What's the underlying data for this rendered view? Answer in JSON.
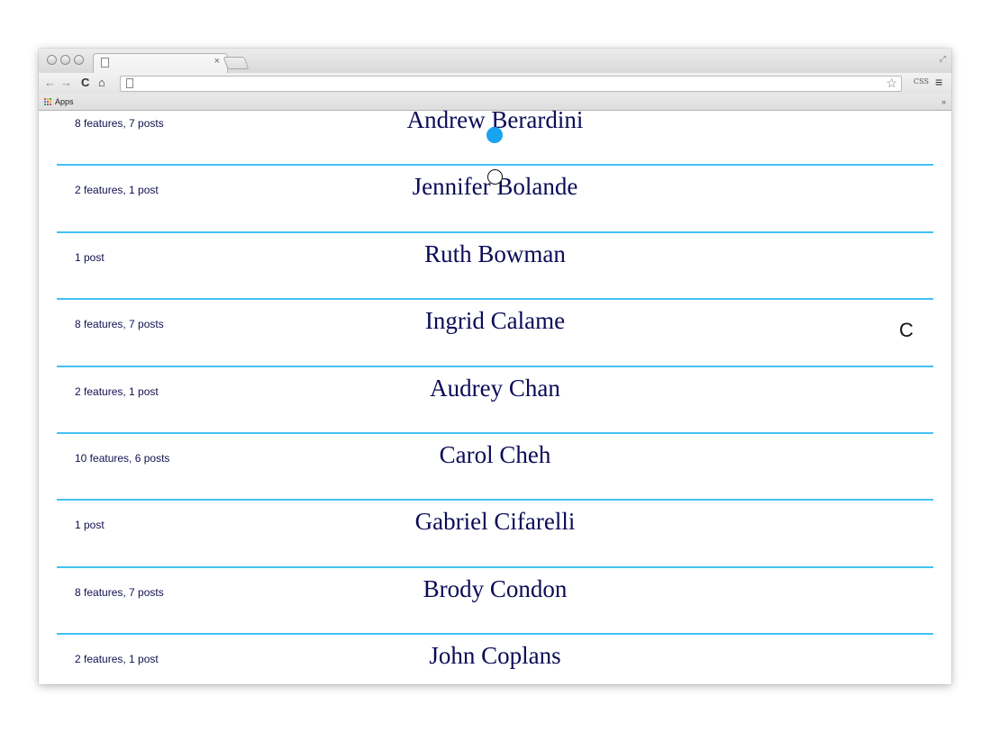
{
  "browser": {
    "tab_close": "×",
    "nav_back": "←",
    "nav_forward": "→",
    "nav_reload": "C",
    "nav_home": "⌂",
    "star": "☆",
    "extension_label": "CSS",
    "menu": "≡",
    "bookmarks_apps_label": "Apps",
    "bookmarks_overflow": "»"
  },
  "artists": [
    {
      "meta": "8 features, 7 posts",
      "name": "Andrew Berardini"
    },
    {
      "meta": "2 features, 1 post",
      "name": "Jennifer Bolande"
    },
    {
      "meta": "1 post",
      "name": "Ruth Bowman"
    },
    {
      "meta": "8 features, 7 posts",
      "name": "Ingrid Calame"
    },
    {
      "meta": "2 features, 1 post",
      "name": "Audrey Chan"
    },
    {
      "meta": "10 features, 6 posts",
      "name": "Carol Cheh"
    },
    {
      "meta": "1 post",
      "name": "Gabriel Cifarelli"
    },
    {
      "meta": "8 features, 7 posts",
      "name": "Brody Condon"
    },
    {
      "meta": "2 features, 1 post",
      "name": "John Coplans"
    }
  ],
  "overlay": {
    "letter": "C",
    "dot_color": "#18a4f0"
  },
  "colors": {
    "divider": "#43c2f2",
    "text": "#0b0b57"
  }
}
